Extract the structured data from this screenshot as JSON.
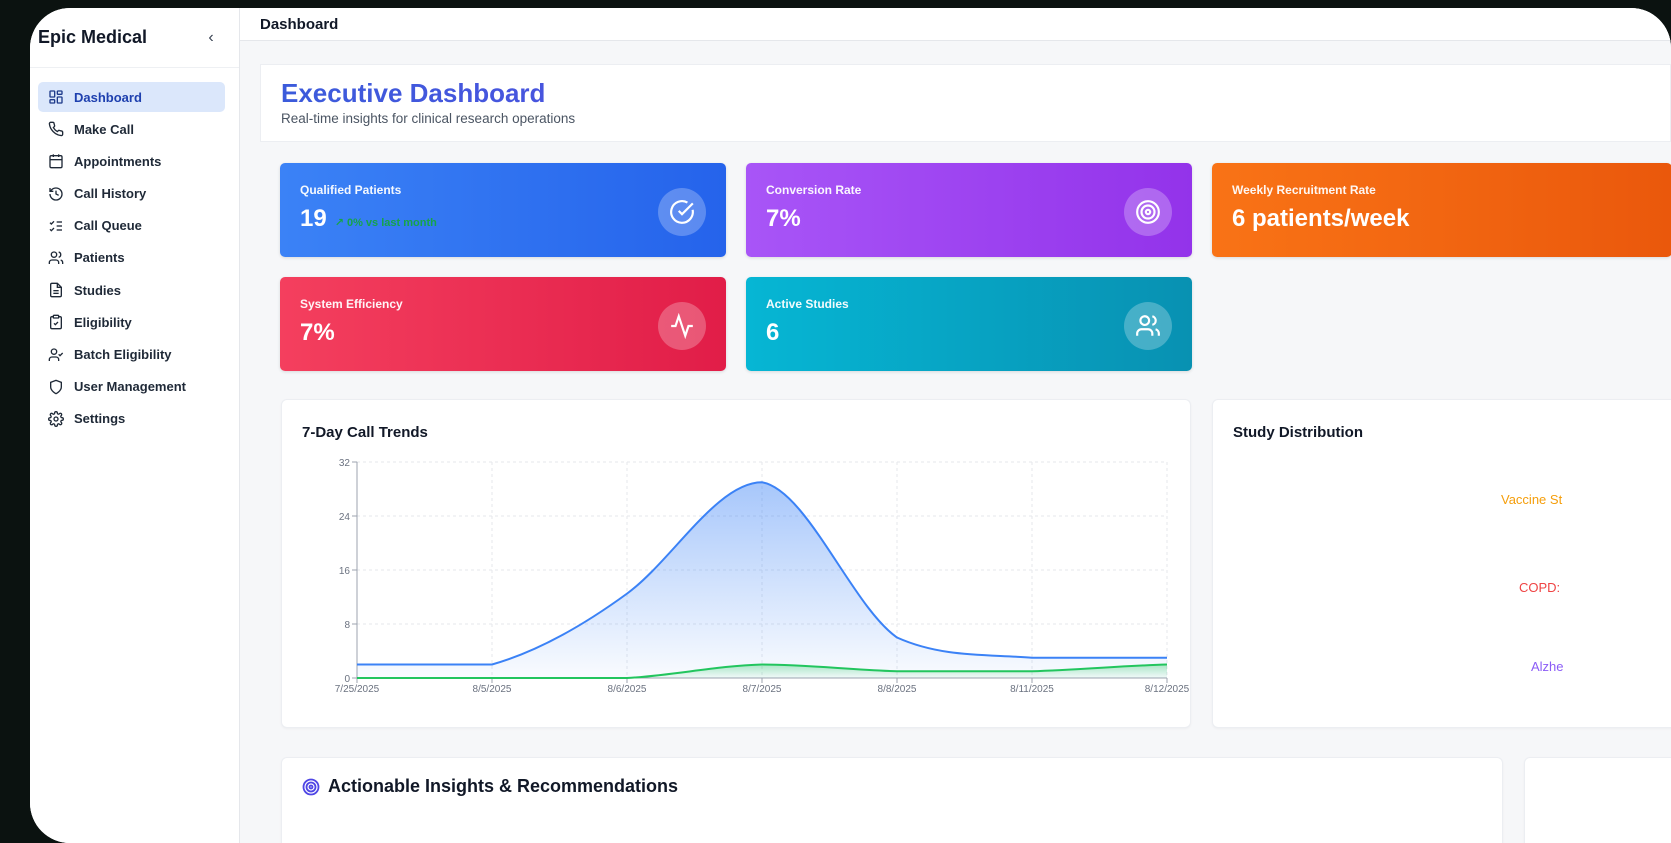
{
  "app": {
    "brand": "Epic Medical",
    "collapse_icon": "‹"
  },
  "sidebar": {
    "items": [
      {
        "label": "Dashboard",
        "icon": "dashboard-grid-icon",
        "active": true
      },
      {
        "label": "Make Call",
        "icon": "phone-icon"
      },
      {
        "label": "Appointments",
        "icon": "calendar-icon"
      },
      {
        "label": "Call History",
        "icon": "history-icon"
      },
      {
        "label": "Call Queue",
        "icon": "list-checks-icon"
      },
      {
        "label": "Patients",
        "icon": "users-icon"
      },
      {
        "label": "Studies",
        "icon": "document-icon"
      },
      {
        "label": "Eligibility",
        "icon": "clipboard-check-icon"
      },
      {
        "label": "Batch Eligibility",
        "icon": "user-check-icon"
      },
      {
        "label": "User Management",
        "icon": "shield-icon"
      },
      {
        "label": "Settings",
        "icon": "gear-icon"
      }
    ]
  },
  "topbar": {
    "title": "Dashboard"
  },
  "header": {
    "title": "Executive Dashboard",
    "subtitle": "Real-time insights for clinical research operations"
  },
  "kpis": {
    "qualified": {
      "label": "Qualified Patients",
      "value": "19",
      "trend": "↗ 0% vs last month",
      "icon": "check-circle-icon"
    },
    "conversion": {
      "label": "Conversion Rate",
      "value": "7%",
      "icon": "target-icon"
    },
    "weekly": {
      "label": "Weekly Recruitment Rate",
      "value": "6 patients/week"
    },
    "efficiency": {
      "label": "System Efficiency",
      "value": "7%",
      "icon": "activity-icon"
    },
    "studies": {
      "label": "Active Studies",
      "value": "6",
      "icon": "users-icon"
    }
  },
  "colors": {
    "blue": "#2563eb",
    "purple": "#9333ea",
    "orange": "#ea580c",
    "red": "#e11d48",
    "cyan": "#0891b2",
    "series_blue": "#3b82f6",
    "series_green": "#22c55e"
  },
  "trend_card": {
    "title": "7-Day Call Trends"
  },
  "distribution_card": {
    "title": "Study Distribution",
    "labels": [
      {
        "text": "Vaccine St",
        "color": "#f59e0b"
      },
      {
        "text": "COPD:",
        "color": "#ef4444"
      },
      {
        "text": "Alzhe",
        "color": "#8b5cf6"
      }
    ]
  },
  "insights": {
    "title": "Actionable Insights & Recommendations",
    "icon": "target-icon"
  },
  "chart_data": {
    "type": "area",
    "title": "7-Day Call Trends",
    "categories": [
      "7/25/2025",
      "8/5/2025",
      "8/6/2025",
      "8/7/2025",
      "8/8/2025",
      "8/11/2025",
      "8/12/2025"
    ],
    "series": [
      {
        "values": [
          2,
          2,
          12.5,
          29,
          6,
          3,
          3
        ],
        "color": "#3b82f6"
      },
      {
        "values": [
          0,
          0,
          0,
          2,
          1,
          1,
          2
        ],
        "color": "#22c55e"
      }
    ],
    "yticks": [
      0,
      8,
      16,
      24,
      32
    ],
    "ylim": [
      0,
      32
    ],
    "grid": true,
    "legend": "none"
  }
}
